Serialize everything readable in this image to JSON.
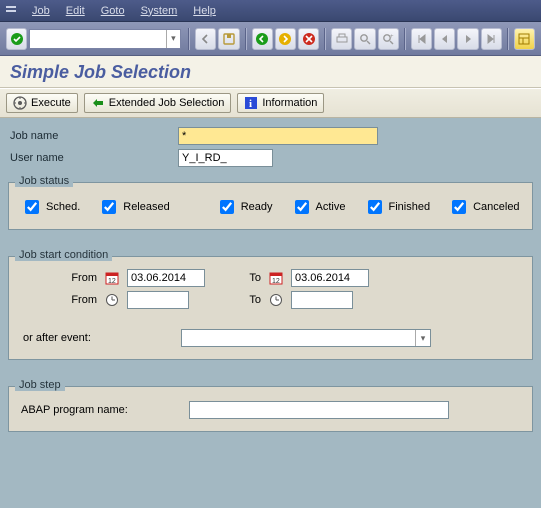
{
  "menu": {
    "items": [
      "Job",
      "Edit",
      "Goto",
      "System",
      "Help"
    ]
  },
  "title": "Simple Job Selection",
  "actions": {
    "execute": "Execute",
    "extended": "Extended Job Selection",
    "info": "Information"
  },
  "fields": {
    "job_name_label": "Job name",
    "job_name_value": "*",
    "user_name_label": "User name",
    "user_name_value": "Y_I_RD_"
  },
  "status": {
    "legend": "Job status",
    "sched": "Sched.",
    "released": "Released",
    "ready": "Ready",
    "active": "Active",
    "finished": "Finished",
    "canceled": "Canceled"
  },
  "cond": {
    "legend": "Job start condition",
    "from": "From",
    "to": "To",
    "date1": "03.06.2014",
    "date2": "03.06.2014",
    "time1": "",
    "time2": "",
    "or_after": "or after event:",
    "event_value": ""
  },
  "step": {
    "legend": "Job step",
    "abap_label": "ABAP program name:",
    "abap_value": ""
  }
}
